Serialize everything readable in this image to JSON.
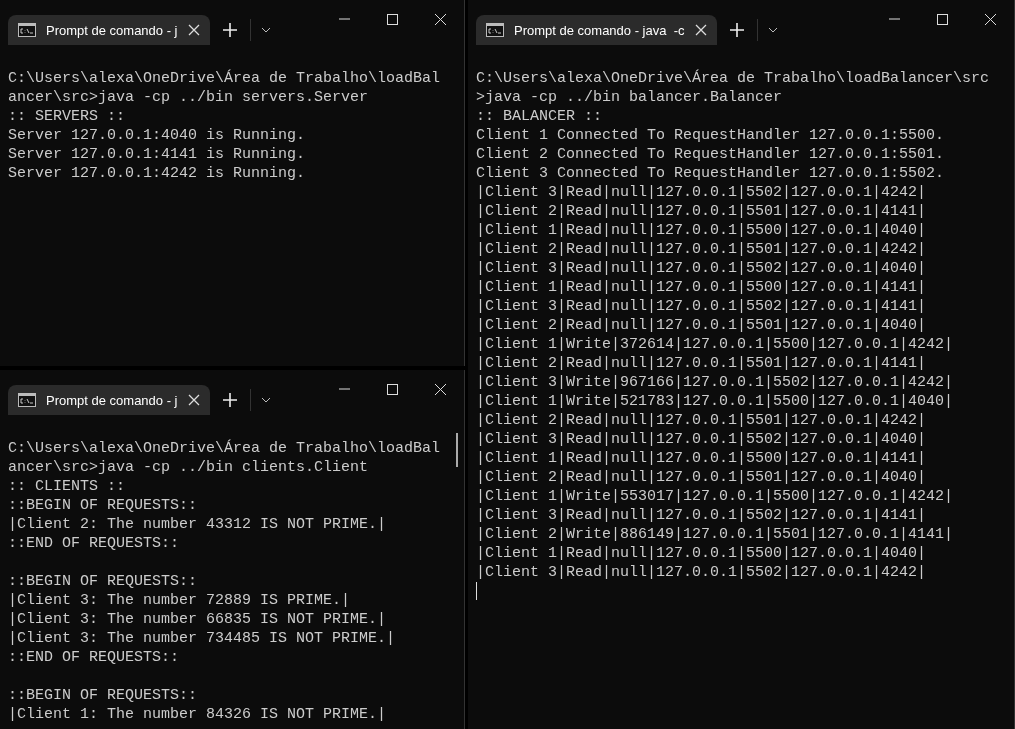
{
  "windows": [
    {
      "tab_title": "Prompt de comando - j",
      "cursor": false,
      "scrollbar": false,
      "blocks": [
        [
          "C:\\Users\\alexa\\OneDrive\\Área de Trabalho\\loadBal",
          "ancer\\src>java -cp ../bin servers.Server",
          ":: SERVERS ::",
          "Server 127.0.0.1:4040 is Running.",
          "Server 127.0.0.1:4141 is Running.",
          "Server 127.0.0.1:4242 is Running."
        ]
      ]
    },
    {
      "tab_title": "Prompt de comando - j",
      "cursor": false,
      "scrollbar": true,
      "blocks": [
        [
          "C:\\Users\\alexa\\OneDrive\\Área de Trabalho\\loadBal",
          "ancer\\src>java -cp ../bin clients.Client",
          ":: CLIENTS ::",
          "::BEGIN OF REQUESTS::",
          "|Client 2: The number 43312 IS NOT PRIME.|",
          "::END OF REQUESTS::"
        ],
        [
          "::BEGIN OF REQUESTS::",
          "|Client 3: The number 72889 IS PRIME.|",
          "|Client 3: The number 66835 IS NOT PRIME.|",
          "|Client 3: The number 734485 IS NOT PRIME.|",
          "::END OF REQUESTS::"
        ],
        [
          "::BEGIN OF REQUESTS::",
          "|Client 1: The number 84326 IS NOT PRIME.|"
        ]
      ]
    },
    {
      "tab_title": "Prompt de comando - java  -c",
      "cursor": true,
      "scrollbar": false,
      "blocks": [
        [
          "C:\\Users\\alexa\\OneDrive\\Área de Trabalho\\loadBalancer\\src",
          ">java -cp ../bin balancer.Balancer",
          ":: BALANCER ::",
          "Client 1 Connected To RequestHandler 127.0.0.1:5500.",
          "Client 2 Connected To RequestHandler 127.0.0.1:5501.",
          "Client 3 Connected To RequestHandler 127.0.0.1:5502.",
          "|Client 3|Read|null|127.0.0.1|5502|127.0.0.1|4242|",
          "|Client 2|Read|null|127.0.0.1|5501|127.0.0.1|4141|",
          "|Client 1|Read|null|127.0.0.1|5500|127.0.0.1|4040|",
          "|Client 2|Read|null|127.0.0.1|5501|127.0.0.1|4242|",
          "|Client 3|Read|null|127.0.0.1|5502|127.0.0.1|4040|",
          "|Client 1|Read|null|127.0.0.1|5500|127.0.0.1|4141|",
          "|Client 3|Read|null|127.0.0.1|5502|127.0.0.1|4141|",
          "|Client 2|Read|null|127.0.0.1|5501|127.0.0.1|4040|",
          "|Client 1|Write|372614|127.0.0.1|5500|127.0.0.1|4242|",
          "|Client 2|Read|null|127.0.0.1|5501|127.0.0.1|4141|",
          "|Client 3|Write|967166|127.0.0.1|5502|127.0.0.1|4242|",
          "|Client 1|Write|521783|127.0.0.1|5500|127.0.0.1|4040|",
          "|Client 2|Read|null|127.0.0.1|5501|127.0.0.1|4242|",
          "|Client 3|Read|null|127.0.0.1|5502|127.0.0.1|4040|",
          "|Client 1|Read|null|127.0.0.1|5500|127.0.0.1|4141|",
          "|Client 2|Read|null|127.0.0.1|5501|127.0.0.1|4040|",
          "|Client 1|Write|553017|127.0.0.1|5500|127.0.0.1|4242|",
          "|Client 3|Read|null|127.0.0.1|5502|127.0.0.1|4141|",
          "|Client 2|Write|886149|127.0.0.1|5501|127.0.0.1|4141|",
          "|Client 1|Read|null|127.0.0.1|5500|127.0.0.1|4040|",
          "|Client 3|Read|null|127.0.0.1|5502|127.0.0.1|4242|"
        ]
      ]
    }
  ]
}
